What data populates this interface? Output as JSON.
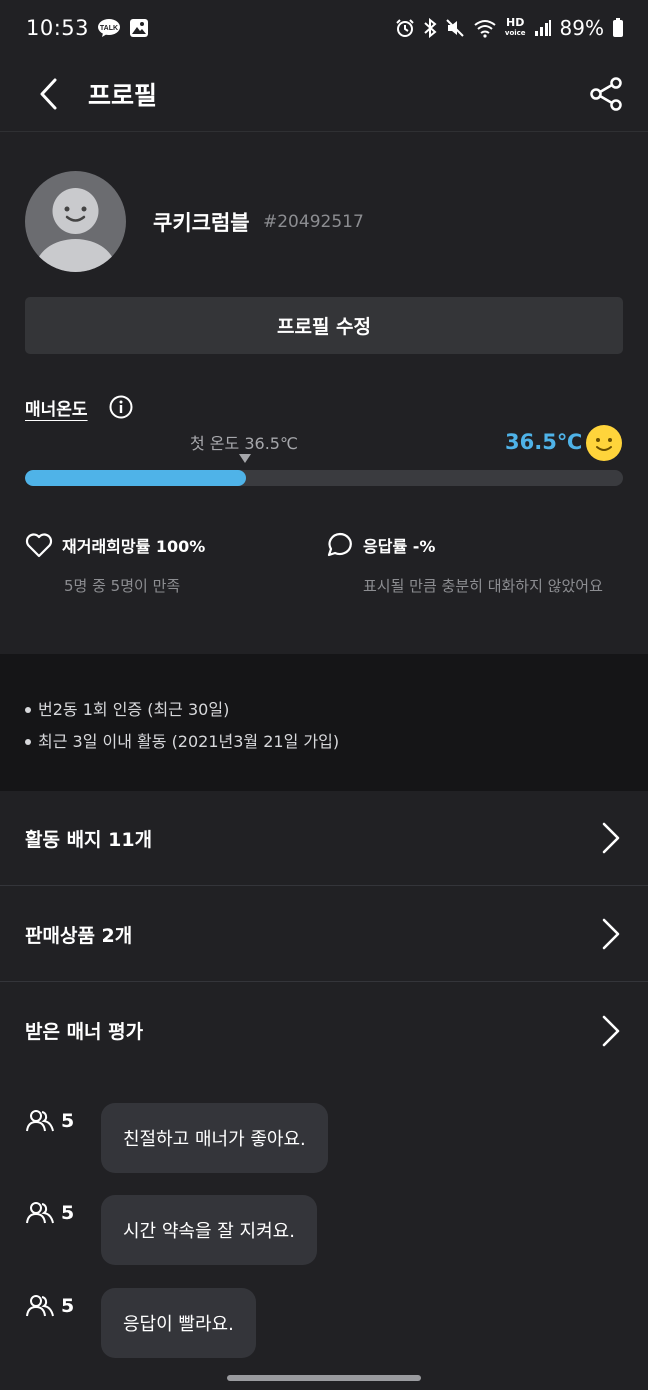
{
  "status_bar": {
    "time": "10:53",
    "battery": "89%",
    "network_label": "HD"
  },
  "appbar": {
    "title": "프로필"
  },
  "profile": {
    "nickname": "쿠키크럼블",
    "user_tag": "#20492517",
    "edit_label": "프로필 수정"
  },
  "manner": {
    "label": "매너온도",
    "first_temp": "첫 온도 36.5℃",
    "temperature": "36.5℃",
    "progress_fraction": 0.37,
    "accent_color": "#4fb3e8"
  },
  "stats": {
    "rehire": {
      "title": "재거래희망률 100%",
      "sub": "5명 중 5명이 만족",
      "icon": "heart-icon"
    },
    "response": {
      "title": "응답률 -%",
      "sub": "표시될 만큼 충분히 대화하지 않았어요",
      "icon": "chat-bubble-icon"
    }
  },
  "info": {
    "lines": [
      "번2동 1회 인증 (최근 30일)",
      "최근 3일 이내 활동 (2021년3월 21일 가입)"
    ]
  },
  "menu": {
    "badges": "활동 배지 11개",
    "products": "판매상품 2개",
    "reviews_title": "받은 매너 평가"
  },
  "reviews": [
    {
      "count": "5",
      "text": "친절하고 매너가 좋아요."
    },
    {
      "count": "5",
      "text": "시간 약속을 잘 지켜요."
    },
    {
      "count": "5",
      "text": "응답이 빨라요."
    }
  ]
}
